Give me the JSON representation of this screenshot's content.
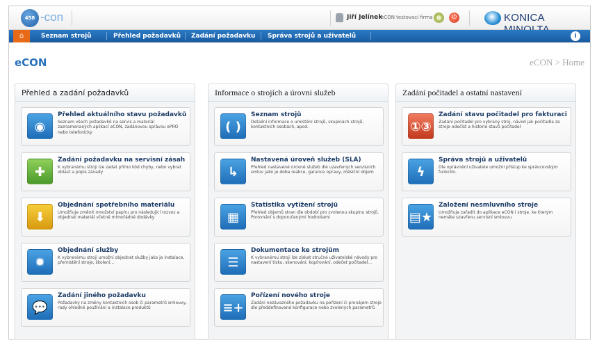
{
  "brand": {
    "logo_badge": "458",
    "logo_text": "-con",
    "vendor": "KONICA MINOLTA"
  },
  "user": {
    "name": "Jiří Jelínek",
    "company": "eCON testovací firma"
  },
  "nav": {
    "home_icon": "home-icon",
    "items": [
      {
        "label": "Seznam strojů"
      },
      {
        "label": "Přehled požadavků"
      },
      {
        "label": "Zadání požadavku"
      },
      {
        "label": "Správa strojů a uživatelů"
      }
    ],
    "info_label": "i"
  },
  "page": {
    "title": "eCON",
    "breadcrumb": "eCON > Home"
  },
  "columns": [
    {
      "title": "Přehled a zadání požadavků",
      "cards": [
        {
          "icon": "eye-icon",
          "color": "#2f86d0",
          "title": "Přehled aktuálního stavu požadavků",
          "desc": "Seznam všech požadavků na servis a materiál zaznamenaných aplikací eCON, zadáno­vou správou ePRO nebo telefonicky"
        },
        {
          "icon": "medkit-icon",
          "color": "#5fae3a",
          "title": "Zadání požadavku na servisní zásah",
          "desc": "K vybranému stroji lze zadat přímo kód chyby, nebo vybrat oblast a popis závady"
        },
        {
          "icon": "supply-box-icon",
          "color": "#e6b21f",
          "title": "Objednání spotřebního materiálu",
          "desc": "Umožňuje změnit množství papíru pro následující rozvoz a objednat materiál včetně mimořádné dodávky"
        },
        {
          "icon": "service-star-icon",
          "color": "#2f86d0",
          "title": "Objednání služby",
          "desc": "K vybranému stroji umožní objednat služby jako je instalace, přemístění stroje, školení..."
        },
        {
          "icon": "speech-bubbles-icon",
          "color": "#2f86d0",
          "title": "Zadání jiného požadavku",
          "desc": "Požadavky na změny kontaktních osob či parametrů smlouvy, rady ohledně používání a instalace produktů"
        }
      ]
    },
    {
      "title": "Informace o strojích a úrovni služeb",
      "cards": [
        {
          "icon": "brackets-icon",
          "color": "#2f86d0",
          "title": "Seznam strojů",
          "desc": "Detailní informace o umístění strojů, skupinách strojů, kontaktních osobách, apod."
        },
        {
          "icon": "arrow-sign-icon",
          "color": "#2f86d0",
          "title": "Nastavená úroveň služeb (SLA)",
          "desc": "Přehled nastavené úrovně služeb dle uzavřených servisních smluv jako je doba reakce, garance opravy, měsíční objem"
        },
        {
          "icon": "chart-grid-icon",
          "color": "#2f86d0",
          "title": "Statistika vytížení strojů",
          "desc": "Přehled objemů stran dle období pro zvolenou skupinu strojů. Porovnání s doporučenými hodnotami"
        },
        {
          "icon": "books-icon",
          "color": "#2f86d0",
          "title": "Dokumentace ke strojům",
          "desc": "K vybranému stroji lze získat stručné uživatelské návody pro nastavení tisku, skenování, kopírování, odečet počitadel..."
        },
        {
          "icon": "add-document-icon",
          "color": "#2f86d0",
          "title": "Pořízení nového stroje",
          "desc": "Zadání nezávazného požadavku na pořízení či pronájem stroje dle předdefinované konfigurace nebo zvolených parametrů"
        }
      ]
    },
    {
      "title": "Zadání počitadel a ostatní nastavení",
      "cards": [
        {
          "icon": "counter-digits-icon",
          "color": "#d9502f",
          "title": "Zadání stavu počitadel pro fakturaci",
          "desc": "Zadání počitadel pro vybraný stroj, návod jak počitadla ze stroje odečíst a historie stavů počitadel"
        },
        {
          "icon": "lightning-icon",
          "color": "#2f86d0",
          "title": "Správa strojů a uživatelů",
          "desc": "Dle oprávnění uživatele umožní přístup ke správcovským funkcím."
        },
        {
          "icon": "new-contract-icon",
          "color": "#2f86d0",
          "title": "Založení nesmluvního stroje",
          "desc": "Umožňuje zařadit do aplikace eCON i stroje, ke kterým nemáte uzavřenu servisní smlouvu"
        }
      ]
    }
  ]
}
